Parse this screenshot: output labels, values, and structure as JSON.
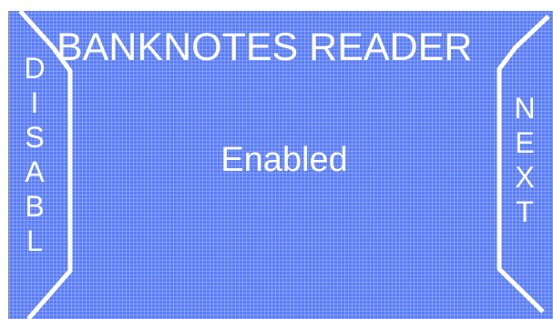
{
  "title": "BANKNOTES READER",
  "status": "Enabled",
  "buttons": {
    "left": {
      "label": "DISABL",
      "letters": [
        "D",
        "I",
        "S",
        "A",
        "B",
        "L"
      ]
    },
    "right": {
      "label": "NEXT",
      "letters": [
        "N",
        "E",
        "X",
        "T"
      ]
    }
  },
  "colors": {
    "panel": "#5a7df5",
    "grid": "#ffffff",
    "text": "#ffffff",
    "outline": "#ffffff"
  }
}
